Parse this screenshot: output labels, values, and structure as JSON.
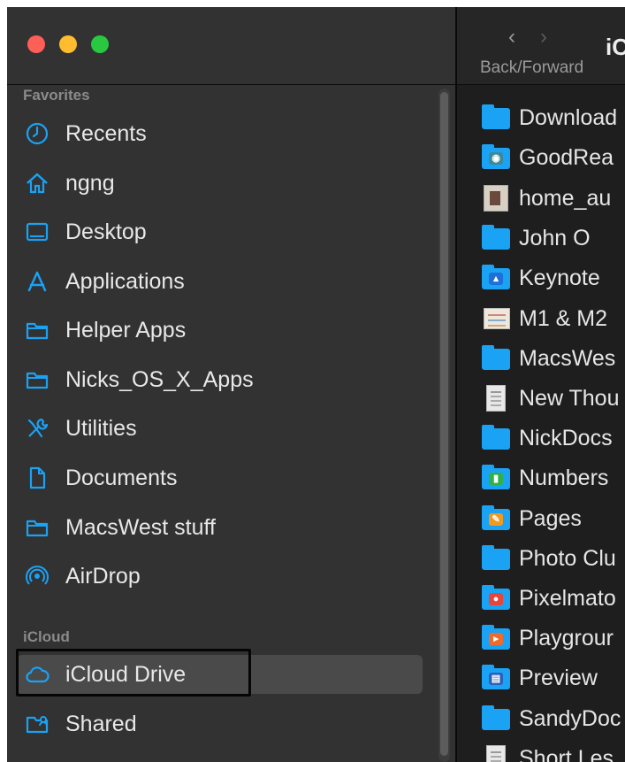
{
  "sidebar": {
    "favorites_label": "Favorites",
    "favorites": [
      {
        "label": "Recents",
        "icon": "clock-icon"
      },
      {
        "label": "ngng",
        "icon": "home-icon"
      },
      {
        "label": "Desktop",
        "icon": "desktop-icon"
      },
      {
        "label": "Applications",
        "icon": "applications-icon"
      },
      {
        "label": "Helper Apps",
        "icon": "folder-icon"
      },
      {
        "label": "Nicks_OS_X_Apps",
        "icon": "folder-icon"
      },
      {
        "label": "Utilities",
        "icon": "utilities-icon"
      },
      {
        "label": "Documents",
        "icon": "document-icon"
      },
      {
        "label": "MacsWest stuff",
        "icon": "folder-icon"
      },
      {
        "label": "AirDrop",
        "icon": "airdrop-icon"
      }
    ],
    "icloud_label": "iCloud",
    "icloud": [
      {
        "label": "iCloud Drive",
        "icon": "cloud-icon",
        "selected": true
      },
      {
        "label": "Shared",
        "icon": "shared-folder-icon"
      }
    ]
  },
  "toolbar": {
    "back_glyph": "‹",
    "forward_glyph": "›",
    "nav_label": "Back/Forward",
    "window_title": "iC"
  },
  "files": [
    {
      "name": "Download",
      "icon": "folder-icon"
    },
    {
      "name": "GoodRea",
      "icon": "goodreader-folder-icon"
    },
    {
      "name": "home_au",
      "icon": "image-thumbnail-icon"
    },
    {
      "name": "John O",
      "icon": "folder-icon"
    },
    {
      "name": "Keynote",
      "icon": "keynote-folder-icon"
    },
    {
      "name": "M1 & M2",
      "icon": "map-thumbnail-icon"
    },
    {
      "name": "MacsWes",
      "icon": "folder-icon"
    },
    {
      "name": "New Thou",
      "icon": "document-thumbnail-icon"
    },
    {
      "name": "NickDocs",
      "icon": "folder-icon"
    },
    {
      "name": "Numbers",
      "icon": "numbers-folder-icon"
    },
    {
      "name": "Pages",
      "icon": "pages-folder-icon"
    },
    {
      "name": "Photo Clu",
      "icon": "folder-icon"
    },
    {
      "name": "Pixelmato",
      "icon": "pixelmator-folder-icon"
    },
    {
      "name": "Playgrour",
      "icon": "playgrounds-folder-icon"
    },
    {
      "name": "Preview",
      "icon": "preview-folder-icon"
    },
    {
      "name": "SandyDoc",
      "icon": "folder-icon"
    },
    {
      "name": "Short Les",
      "icon": "document-thumbnail-icon"
    }
  ],
  "colors": {
    "accent": "#1aa2f5",
    "sidebar_bg": "#323232",
    "selection_bg": "#4a4a4a"
  }
}
